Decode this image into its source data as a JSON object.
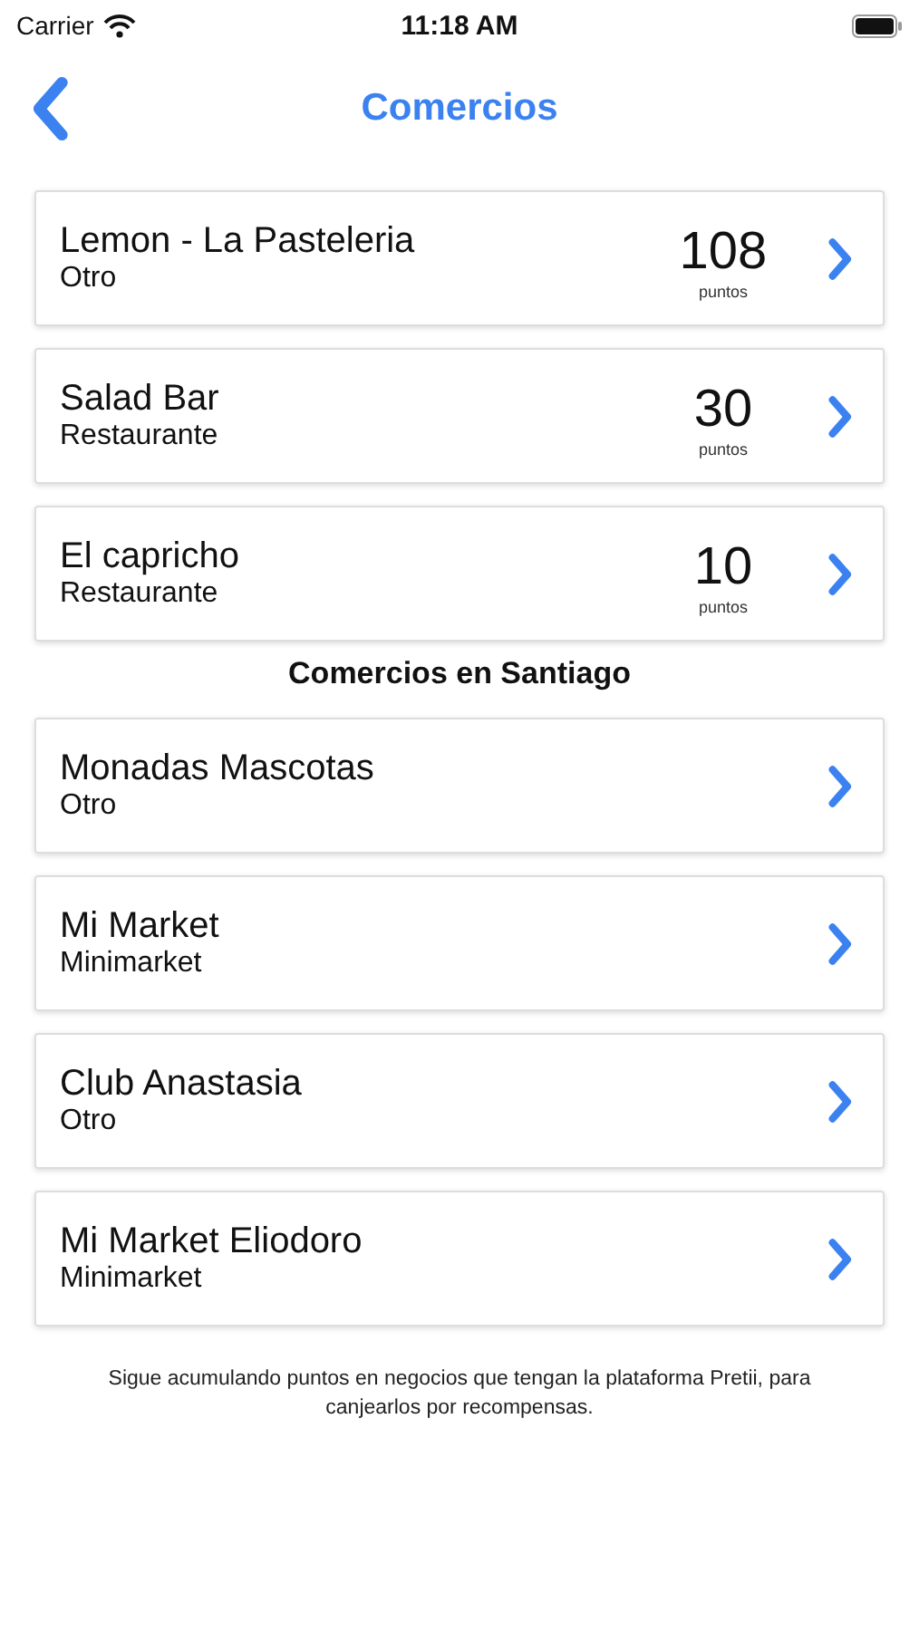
{
  "status_bar": {
    "carrier": "Carrier",
    "time": "11:18 AM"
  },
  "nav": {
    "title": "Comercios"
  },
  "sections": [
    {
      "items": [
        {
          "name": "Lemon - La Pasteleria",
          "category": "Otro",
          "points": "108",
          "points_label": "puntos"
        },
        {
          "name": "Salad Bar",
          "category": "Restaurante",
          "points": "30",
          "points_label": "puntos"
        },
        {
          "name": "El capricho",
          "category": "Restaurante",
          "points": "10",
          "points_label": "puntos"
        }
      ]
    },
    {
      "title": "Comercios en Santiago",
      "items": [
        {
          "name": "Monadas Mascotas",
          "category": "Otro"
        },
        {
          "name": "Mi Market",
          "category": "Minimarket"
        },
        {
          "name": "Club Anastasia",
          "category": "Otro"
        },
        {
          "name": "Mi Market Eliodoro",
          "category": "Minimarket"
        }
      ]
    }
  ],
  "footer": "Sigue acumulando puntos en negocios que tengan la plataforma Pretii, para canjearlos por recompensas."
}
